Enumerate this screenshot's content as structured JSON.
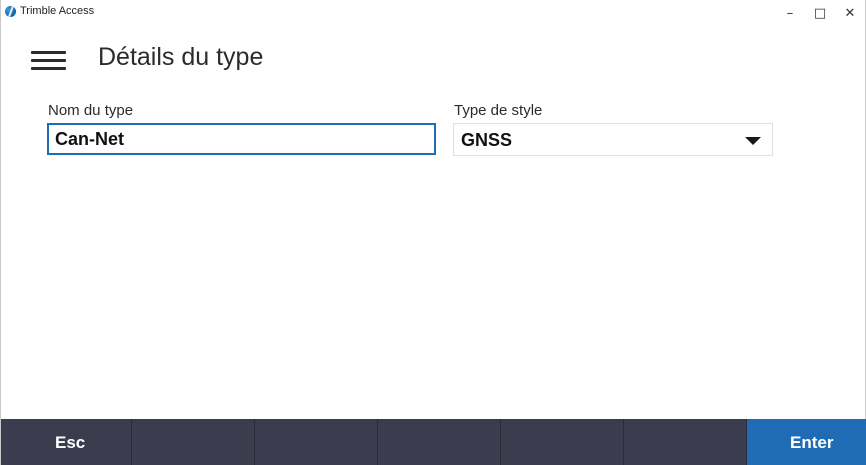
{
  "window": {
    "app_title": "Trimble Access",
    "logo_icon": "trimble-globe-icon",
    "minimize_glyph": "–",
    "maximize_glyph": "□",
    "close_glyph": "✕"
  },
  "header": {
    "menu_icon": "hamburger-menu-icon",
    "title": "Détails du type"
  },
  "form": {
    "name_label": "Nom du type",
    "name_value": "Can-Net",
    "style_label": "Type de style",
    "style_value": "GNSS",
    "style_arrow_icon": "dropdown-arrow-icon"
  },
  "softkeys": {
    "esc_label": "Esc",
    "enter_label": "Enter",
    "colors": {
      "bar": "#3b3d4f",
      "enter": "#1f6cb5"
    }
  },
  "colors": {
    "accent": "#1f6cb5",
    "text": "#2b2b2b"
  }
}
